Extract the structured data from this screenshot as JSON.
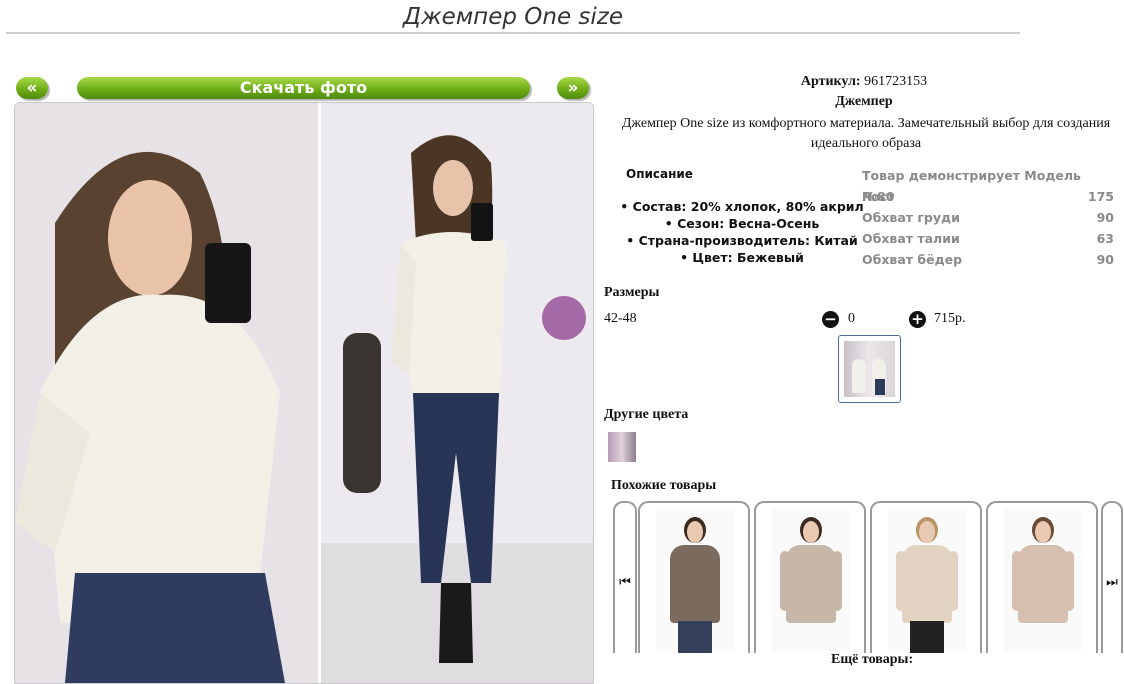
{
  "page": {
    "title": "Джемпер One size"
  },
  "gallery": {
    "prev_label": "«",
    "next_label": "»",
    "download_label": "Скачать фото"
  },
  "product": {
    "sku_label": "Артикул:",
    "sku": "961723153",
    "name": "Джемпер",
    "description": "Джемпер One size из комфортного материала. Замечательный выбор для создания идеального образа",
    "details_heading": "Описание",
    "details": [
      "Состав: 20% хлопок, 80% акрил",
      "Сезон: Весна-Осень",
      "Страна-производитель: Китай",
      "Цвет: Бежевый"
    ],
    "model_heading": "Товар демонстрирует Модель №80",
    "model": [
      {
        "label": "Рост",
        "value": "175"
      },
      {
        "label": "Обхват груди",
        "value": "90"
      },
      {
        "label": "Обхват талии",
        "value": "63"
      },
      {
        "label": "Обхват бёдер",
        "value": "90"
      }
    ]
  },
  "sizes": {
    "heading": "Размеры",
    "rows": [
      {
        "size": "42-48",
        "qty": "0",
        "price": "715р."
      }
    ],
    "minus_icon": "minus-circle-icon",
    "plus_icon": "plus-circle-icon"
  },
  "other_colors": {
    "heading": "Другие цвета"
  },
  "similar": {
    "heading": "Похожие товары",
    "prev_icon": "skip-back-icon",
    "next_icon": "skip-forward-icon",
    "prev_glyph": "⏮",
    "next_glyph": "⏭",
    "items": [
      {
        "color": "#7b6a5e"
      },
      {
        "color": "#c6b7a8"
      },
      {
        "color": "#e2d2c2"
      },
      {
        "color": "#d6bfae"
      }
    ]
  },
  "more": {
    "heading": "Ещё товары:"
  },
  "colors": {
    "accent": "#6fae17",
    "link": "#1f7a1f",
    "border": "#9a9a9a"
  }
}
